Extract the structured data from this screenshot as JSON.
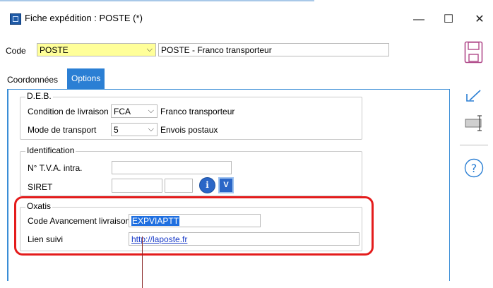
{
  "window": {
    "title": "Fiche expédition : POSTE (*)",
    "min": "—",
    "max": "☐",
    "close": "✕"
  },
  "header": {
    "code_label": "Code",
    "code_value": "POSTE",
    "code_description": "POSTE  - Franco transporteur"
  },
  "tabs": [
    {
      "label": "Coordonnées"
    },
    {
      "label": "Options"
    }
  ],
  "deb": {
    "title": "D.E.B.",
    "condition_label": "Condition de livraison",
    "condition_value": "FCA",
    "condition_desc": "Franco transporteur",
    "transport_label": "Mode de transport",
    "transport_value": "5",
    "transport_desc": "Envois postaux"
  },
  "identification": {
    "title": "Identification",
    "tva_label": "N° T.V.A. intra.",
    "tva_value": "",
    "siret_label": "SIRET",
    "siret_value1": "",
    "siret_value2": "",
    "info_btn": "i",
    "v_btn": "V"
  },
  "oxatis": {
    "title": "Oxatis",
    "code_label": "Code Avancement livraison",
    "code_value": "EXPVIAPTT",
    "lien_label": "Lien suivi",
    "lien_value": "http://laposte.fr"
  },
  "tools": {
    "save_icon": "save-icon",
    "undo_icon": "undo-icon",
    "field_icon": "field-icon",
    "help_icon": "help-icon",
    "help_glyph": "?"
  },
  "colors": {
    "accent": "#2b7fd4",
    "highlight_box": "#e41c1c",
    "code_field_bg": "#ffff99"
  }
}
